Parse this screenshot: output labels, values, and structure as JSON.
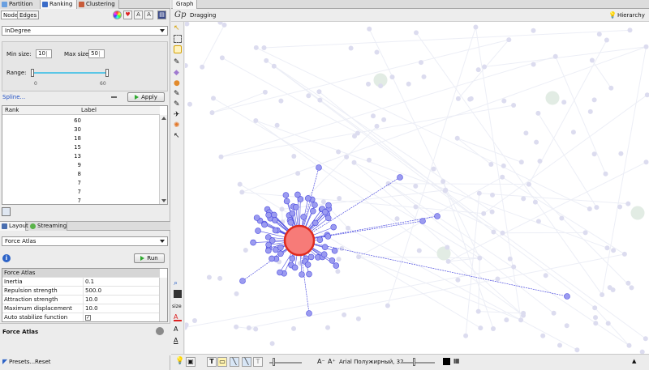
{
  "left_tabs": [
    "Partition",
    "Ranking",
    "Clustering"
  ],
  "ranking": {
    "nodes_label": "Nodes",
    "edges_label": "Edges",
    "attribute": "InDegree",
    "min_size_label": "Min size:",
    "min_size_value": "10",
    "max_size_label": "Max size:",
    "max_size_value": "50",
    "range_label": "Range:",
    "range_min": "0",
    "range_max": "60",
    "spline_label": "Spline...",
    "apply_label": "Apply",
    "table_headers": [
      "Rank",
      "Label"
    ],
    "rank_values": [
      "60",
      "30",
      "18",
      "15",
      "13",
      "9",
      "8",
      "7",
      "7",
      "7"
    ]
  },
  "layout_tabs": [
    "Layout",
    "Streaming"
  ],
  "layout": {
    "algorithm": "Force Atlas",
    "run_label": "Run",
    "props_header": "Force Atlas",
    "props": [
      {
        "name": "Inertia",
        "value": "0.1"
      },
      {
        "name": "Repulsion strength",
        "value": "500.0"
      },
      {
        "name": "Attraction strength",
        "value": "10.0"
      },
      {
        "name": "Maximum displacement",
        "value": "10.0"
      },
      {
        "name": "Auto stabilize function",
        "value": "✓"
      }
    ],
    "description_title": "Force Atlas",
    "presets_label": "Presets...",
    "reset_label": "Reset"
  },
  "graph": {
    "tab_title": "Graph",
    "mode_label": "Dragging",
    "hierarchy_label": "Hierarchy",
    "font_label": "Arial Полужирный, 32",
    "size_label": "size"
  },
  "colors": {
    "node": "#9b9bf0",
    "node_stroke": "#4b4be0",
    "hub": "#f77b78",
    "hub_stroke": "#e02a1d",
    "faded_node": "#dcdcef",
    "accent": "#5ac6e6"
  }
}
